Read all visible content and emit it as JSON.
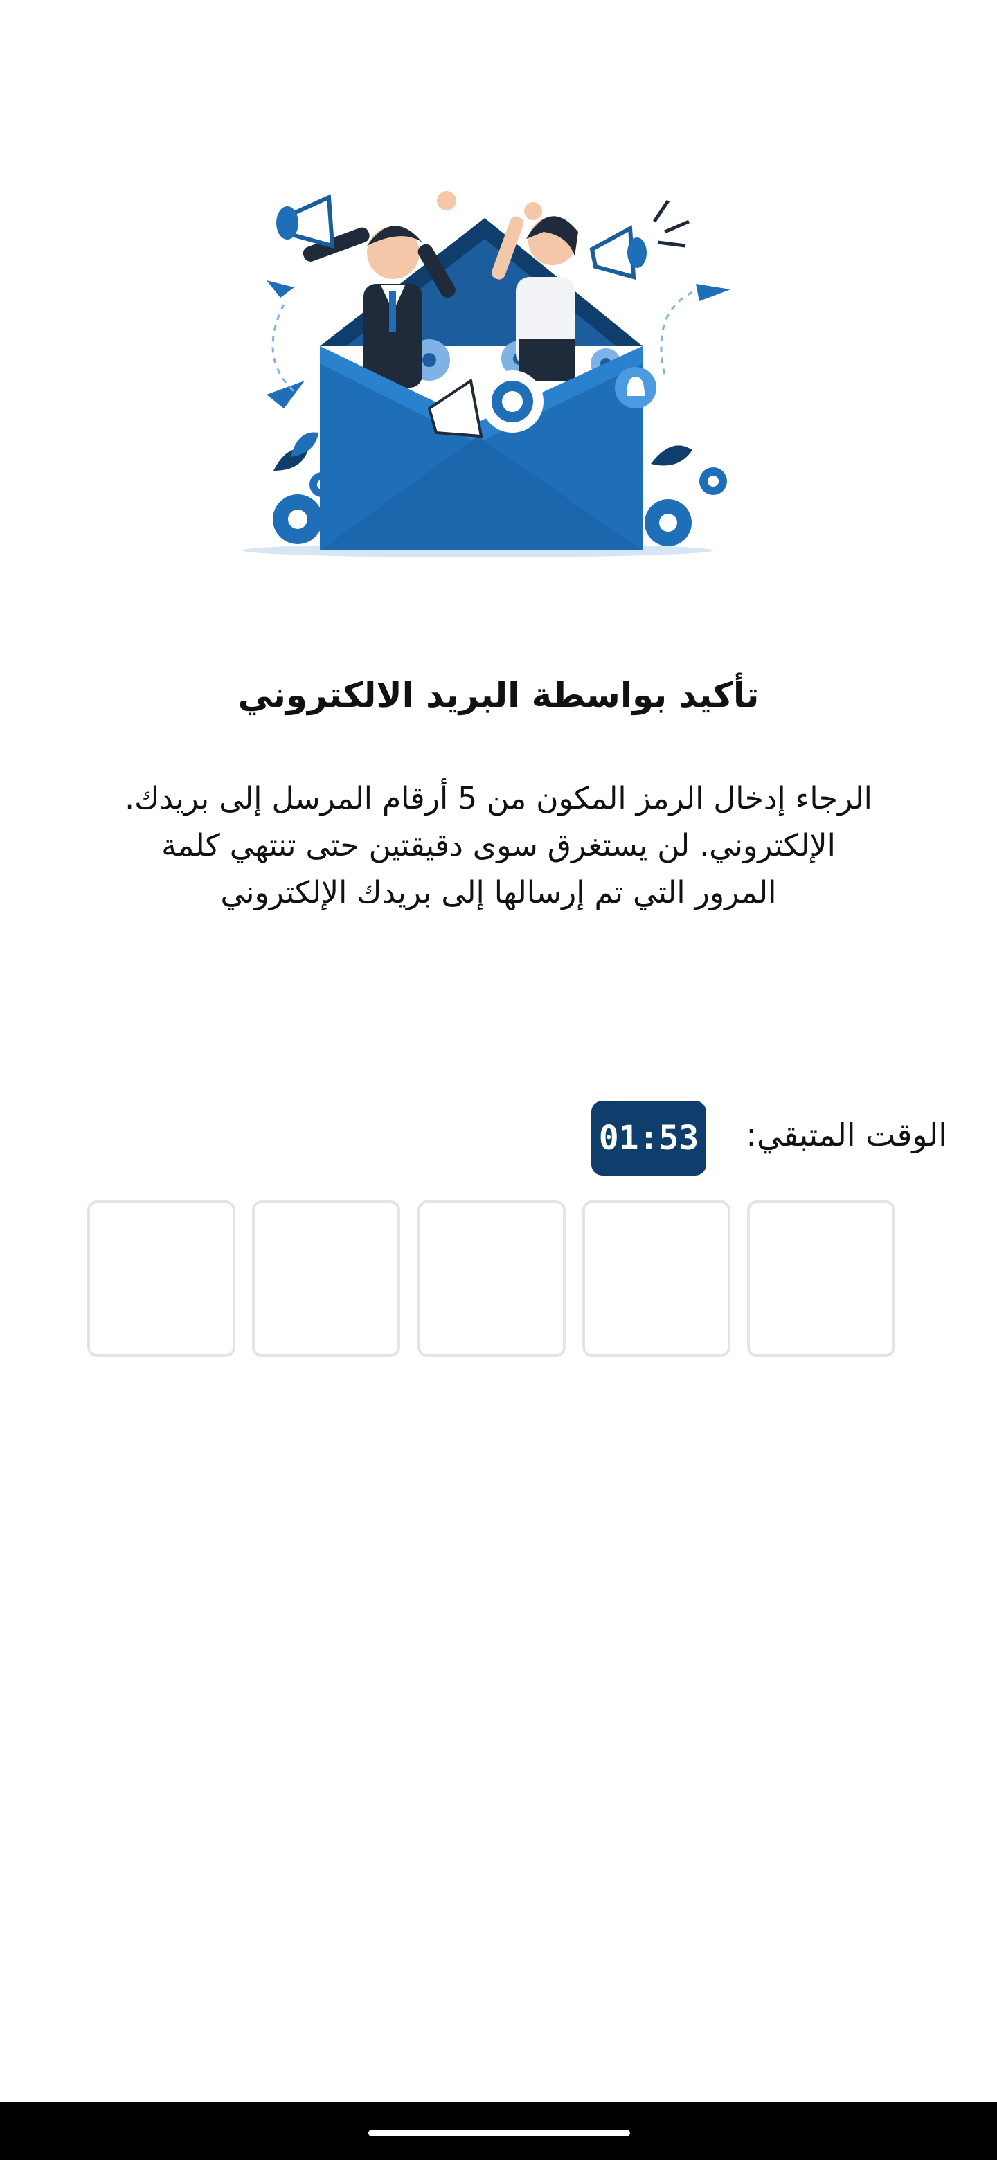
{
  "page": {
    "title": "تأكيد بواسطة البريد الالكتروني",
    "description_lines": [
      ".الرجاء إدخال الرمز المكون من 5 أرقام المرسل إلى بريدك",
      "الإلكتروني. لن يستغرق سوى دقيقتين حتى تنتهي كلمة",
      "المرور التي تم إرسالها إلى بريدك الإلكتروني"
    ]
  },
  "timer": {
    "label": "الوقت المتبقي:",
    "value": "01:53"
  },
  "otp": {
    "length": 5,
    "digits": [
      "",
      "",
      "",
      "",
      ""
    ]
  },
  "illustration": {
    "icon": "email-announcement-illustration",
    "colors": {
      "primary": "#1e6fb8",
      "dark": "#0f3e6c",
      "light": "#7fb2e5"
    }
  },
  "colors": {
    "timer_badge": "#0f3e6c",
    "box_border": "#e4e4e4"
  }
}
